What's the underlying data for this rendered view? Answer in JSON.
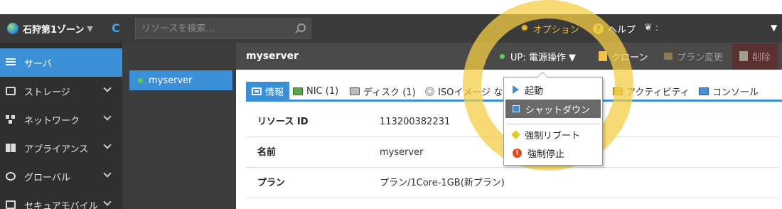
{
  "topbar": {
    "zone_label": "石狩第1ゾーン",
    "zone_caret": "▼",
    "refresh_glyph": "C",
    "search_placeholder": "リソースを検索...",
    "options_label": "オプション",
    "help_label": "ヘルプ",
    "help_glyph": "?",
    "leaf_glyph": "❦",
    "leaf_suffix": ":",
    "menu_caret": "▼"
  },
  "leftnav": {
    "items": [
      {
        "label": "サーバ",
        "icon": "server-icon",
        "active": true
      },
      {
        "label": "ストレージ",
        "icon": "storage-icon"
      },
      {
        "label": "ネットワーク",
        "icon": "network-icon"
      },
      {
        "label": "アプライアンス",
        "icon": "appliance-icon"
      },
      {
        "label": "グローバル",
        "icon": "globe-icon"
      },
      {
        "label": "セキュアモバイル",
        "icon": "mobile-icon"
      }
    ]
  },
  "server_list": {
    "items": [
      {
        "name": "myserver",
        "status": "up"
      }
    ]
  },
  "detail": {
    "title": "myserver",
    "power_button": "UP: 電源操作 ▼",
    "clone_button": "クローン",
    "plan_button": "プラン変更",
    "delete_button": "削除"
  },
  "tabs": [
    {
      "label": "情報",
      "icon": "info-icon"
    },
    {
      "label": "NIC (1)",
      "icon": "nic-icon"
    },
    {
      "label": "ディスク (1)",
      "icon": "disk-icon"
    },
    {
      "label": "ISOイメージ なし",
      "icon": "iso-icon"
    },
    {
      "label": "アクティビティ",
      "icon": "activity-icon"
    },
    {
      "label": "コンソール",
      "icon": "console-icon"
    }
  ],
  "info_rows": [
    {
      "label": "リソース ID",
      "value": "113200382231"
    },
    {
      "label": "名前",
      "value": "myserver"
    },
    {
      "label": "プラン",
      "value": "プラン/1Core-1GB(新プラン)"
    }
  ],
  "power_menu": {
    "items": [
      {
        "label": "起動",
        "icon": "play-icon"
      },
      {
        "label": "シャットダウン",
        "icon": "shutdown-icon",
        "highlighted": true
      },
      {
        "label": "強制リブート",
        "icon": "warning-icon"
      },
      {
        "label": "強制停止",
        "icon": "force-stop-icon",
        "force_glyph": "!"
      }
    ]
  },
  "colors": {
    "accent": "#3b8fd6",
    "topbar": "#3a3a3a",
    "highlight_ring": "#f5cd46",
    "status_up": "#56d14e",
    "options": "#e8b624"
  }
}
